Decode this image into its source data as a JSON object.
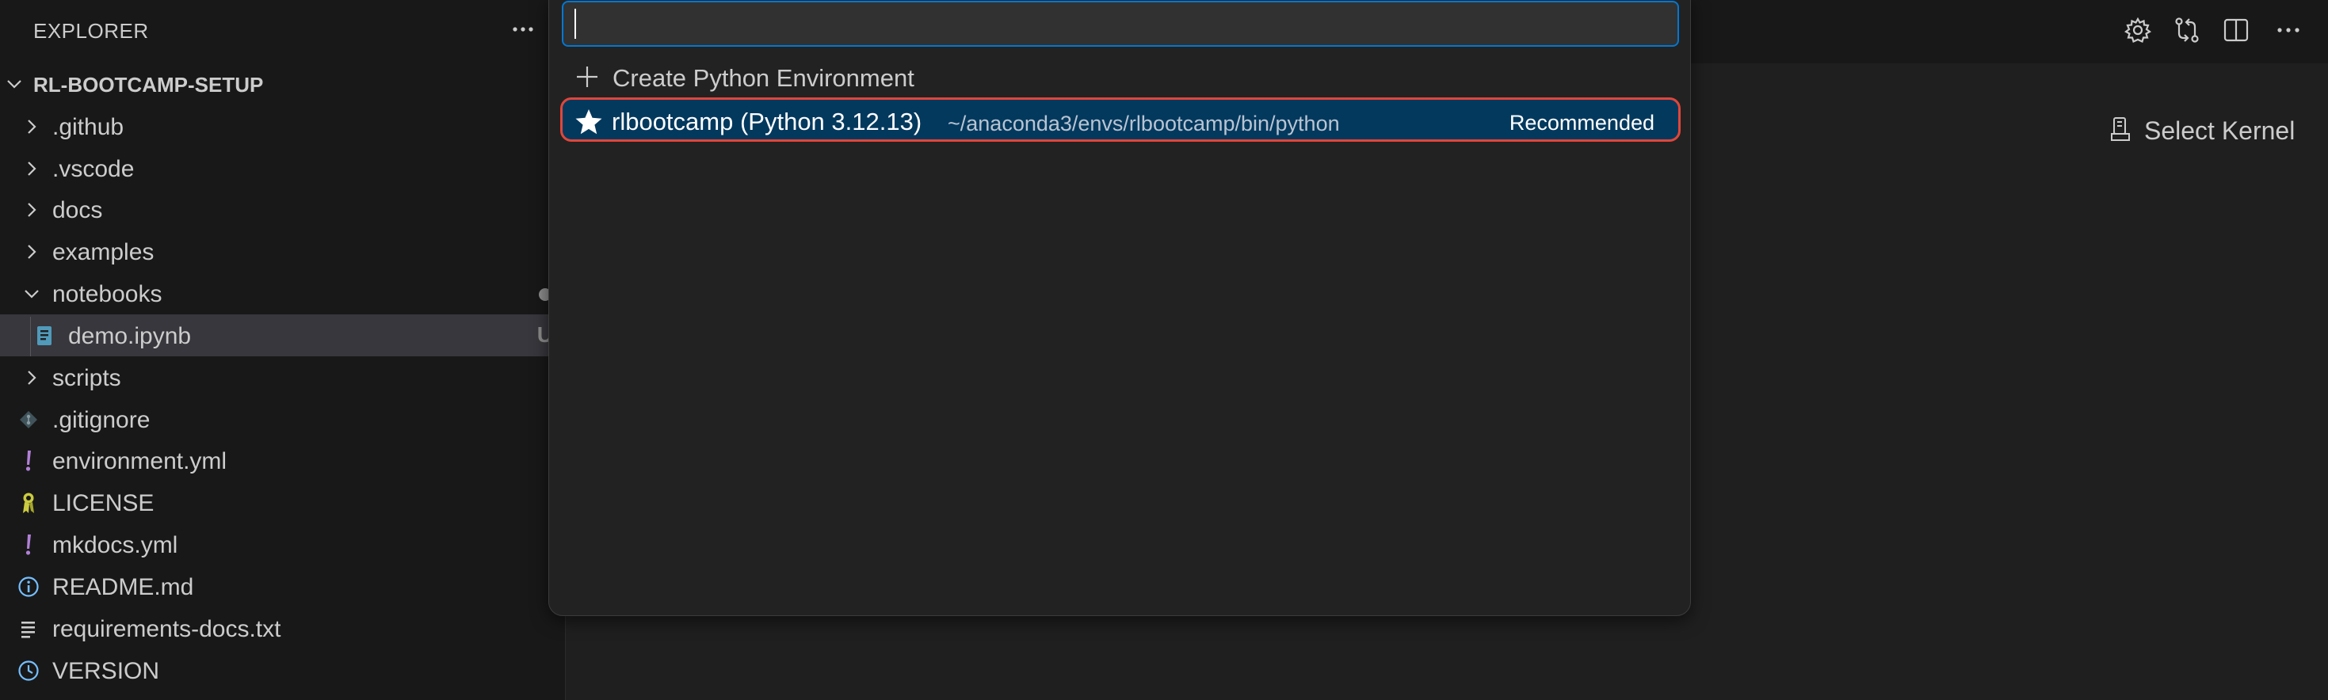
{
  "explorer": {
    "title": "EXPLORER",
    "root": "RL-BOOTCAMP-SETUP",
    "items": [
      {
        "label": ".github",
        "kind": "folder-collapsed"
      },
      {
        "label": ".vscode",
        "kind": "folder-collapsed"
      },
      {
        "label": "docs",
        "kind": "folder-collapsed"
      },
      {
        "label": "examples",
        "kind": "folder-collapsed"
      },
      {
        "label": "notebooks",
        "kind": "folder-expanded"
      },
      {
        "label": "demo.ipynb",
        "kind": "notebook-file",
        "badge": "U"
      },
      {
        "label": "scripts",
        "kind": "folder-collapsed"
      },
      {
        "label": ".gitignore",
        "kind": "git-file"
      },
      {
        "label": "environment.yml",
        "kind": "yaml-file"
      },
      {
        "label": "LICENSE",
        "kind": "license-file"
      },
      {
        "label": "mkdocs.yml",
        "kind": "yaml-file"
      },
      {
        "label": "README.md",
        "kind": "info-file"
      },
      {
        "label": "requirements-docs.txt",
        "kind": "text-file"
      },
      {
        "label": "VERSION",
        "kind": "version-file"
      }
    ]
  },
  "quick_pick": {
    "input_value": "",
    "items": [
      {
        "label": "Create Python Environment",
        "icon": "plus-icon"
      },
      {
        "label": "rlbootcamp (Python 3.12.13)",
        "description": "~/anaconda3/envs/rlbootcamp/bin/python",
        "tag": "Recommended",
        "icon": "star-icon"
      }
    ]
  },
  "editor": {
    "kernel_label": "Select Kernel",
    "toolbar_icons": [
      "gear-icon",
      "compare-changes-icon",
      "split-editor-icon",
      "more-actions-icon"
    ]
  },
  "colors": {
    "accent_blue": "#0078d4",
    "selection_bg": "#04395e",
    "highlight_border": "#e0463a",
    "yaml_purple": "#b180d7",
    "license_yellow": "#cbcb41",
    "info_blue": "#75beff"
  }
}
